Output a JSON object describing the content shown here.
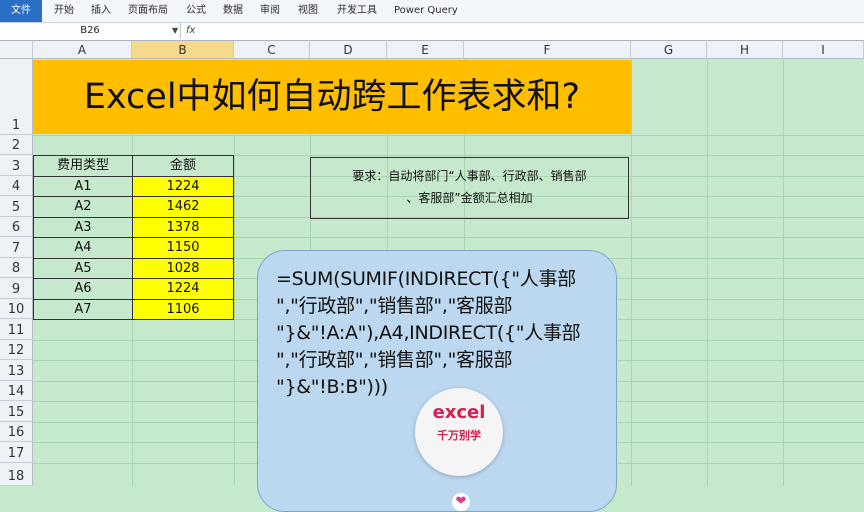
{
  "ribbon": {
    "tabs": [
      "文件",
      "开始",
      "插入",
      "页面布局",
      "公式",
      "数据",
      "审阅",
      "视图",
      "开发工具",
      "Power Query"
    ]
  },
  "formula_bar": {
    "name_box": "B26",
    "fx": "fx"
  },
  "columns": [
    "A",
    "B",
    "C",
    "D",
    "E",
    "F",
    "G",
    "H",
    "I"
  ],
  "rows": [
    "1",
    "2",
    "3",
    "4",
    "5",
    "6",
    "7",
    "8",
    "9",
    "10",
    "11",
    "12",
    "13",
    "14",
    "15",
    "16",
    "17",
    "18"
  ],
  "title": "Excel中如何自动跨工作表求和?",
  "table": {
    "headers": [
      "费用类型",
      "金额"
    ],
    "rows": [
      [
        "A1",
        "1224"
      ],
      [
        "A2",
        "1462"
      ],
      [
        "A3",
        "1378"
      ],
      [
        "A4",
        "1150"
      ],
      [
        "A5",
        "1028"
      ],
      [
        "A6",
        "1224"
      ],
      [
        "A7",
        "1106"
      ]
    ]
  },
  "requirement": {
    "line1": "要求：自动将部门“人事部、行政部、销售部",
    "line2": "、客服部”金额汇总相加"
  },
  "formula_lines": [
    "=SUM(SUMIF(INDIRECT({\"人事部",
    "\",\"行政部\",\"销售部\",\"客服部",
    "\"}&\"!A:A\"),A4,INDIRECT({\"人事部",
    "\",\"行政部\",\"销售部\",\"客服部",
    "\"}&\"!B:B\")))"
  ],
  "logo": {
    "main": "excel",
    "sub": "千万别学"
  },
  "colors": {
    "sheet_bg": "#c6e8cc",
    "title_bg": "#ffbf00",
    "value_bg": "#ffff00",
    "formula_box_bg": "#bcd8f0",
    "file_tab": "#2a6ec5"
  }
}
